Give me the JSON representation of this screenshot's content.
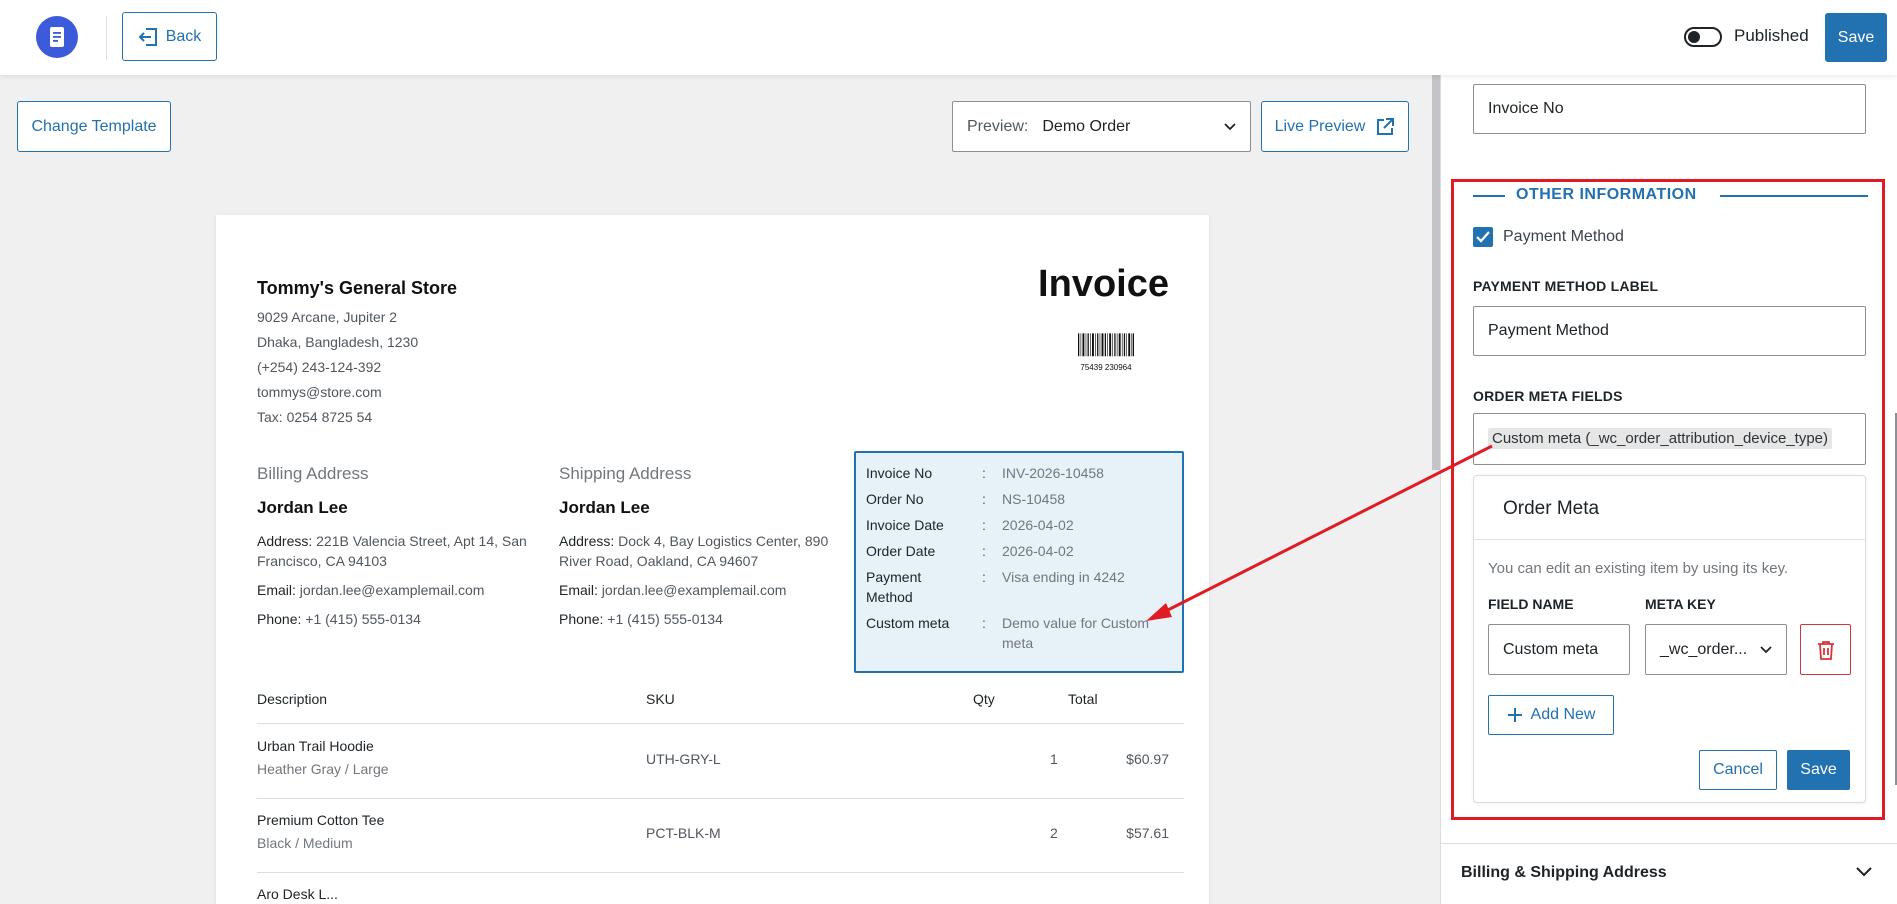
{
  "topbar": {
    "back_label": "Back",
    "published_label": "Published",
    "save_label": "Save"
  },
  "toolbar": {
    "change_template_label": "Change Template",
    "preview_label": "Preview:",
    "preview_value": "Demo Order",
    "live_preview_label": "Live Preview"
  },
  "invoice": {
    "store_name": "Tommy's General Store",
    "store_lines": [
      "9029 Arcane, Jupiter 2",
      "Dhaka, Bangladesh, 1230",
      "(+254) 243-124-392",
      "tommys@store.com",
      "Tax: 0254 8725 54"
    ],
    "title": "Invoice",
    "barcode_text": "75439 230964",
    "billing": {
      "title": "Billing Address",
      "name": "Jordan Lee",
      "address_label": "Address:",
      "address": "221B Valencia Street, Apt 14, San Francisco, CA 94103",
      "email_label": "Email:",
      "email": "jordan.lee@examplemail.com",
      "phone_label": "Phone:",
      "phone": "+1 (415) 555-0134"
    },
    "shipping": {
      "title": "Shipping Address",
      "name": "Jordan Lee",
      "address_label": "Address:",
      "address": "Dock 4, Bay Logistics Center, 890 River Road, Oakland, CA 94607",
      "email_label": "Email:",
      "email": "jordan.lee@examplemail.com",
      "phone_label": "Phone:",
      "phone": "+1 (415) 555-0134"
    },
    "meta": [
      {
        "key": "Invoice No",
        "value": "INV-2026-10458"
      },
      {
        "key": "Order No",
        "value": "NS-10458"
      },
      {
        "key": "Invoice Date",
        "value": "2026-04-02"
      },
      {
        "key": "Order Date",
        "value": "2026-04-02"
      },
      {
        "key": "Payment Method",
        "value": "Visa ending in 4242"
      },
      {
        "key": "Custom meta",
        "value": "Demo value for Custom meta"
      }
    ],
    "meta_separator": ":",
    "columns": [
      "Description",
      "SKU",
      "Qty",
      "Total"
    ],
    "items": [
      {
        "name": "Urban Trail Hoodie",
        "variant": "Heather Gray / Large",
        "sku": "UTH-GRY-L",
        "qty": "1",
        "total": "$60.97"
      },
      {
        "name": "Premium Cotton Tee",
        "variant": "Black / Medium",
        "sku": "PCT-BLK-M",
        "qty": "2",
        "total": "$57.61"
      },
      {
        "name": "Aro Desk L...",
        "variant": "",
        "sku": "",
        "qty": "",
        "total": ""
      }
    ]
  },
  "panel": {
    "invoice_no_value": "Invoice No",
    "section_title": "OTHER INFORMATION",
    "payment_method_checkbox": "Payment Method",
    "payment_method_checked": true,
    "payment_method_label_title": "PAYMENT METHOD LABEL",
    "payment_method_label_value": "Payment Method",
    "order_meta_fields_title": "ORDER META FIELDS",
    "order_meta_tag": "Custom meta (_wc_order_attribution_device_type)",
    "order_meta_card": {
      "title": "Order Meta",
      "help": "You can edit an existing item by using its key.",
      "field_name_label": "FIELD NAME",
      "meta_key_label": "META KEY",
      "field_name_value": "Custom meta",
      "meta_key_value": "_wc_order...",
      "add_new_label": "Add New",
      "cancel_label": "Cancel",
      "save_label": "Save"
    },
    "accordion_title": "Billing & Shipping Address"
  },
  "colors": {
    "accent": "#2271b1",
    "highlight": "#e01b24",
    "logo": "#3b5bdb",
    "meta_bg": "#e6f2f8",
    "danger": "#d63638"
  }
}
